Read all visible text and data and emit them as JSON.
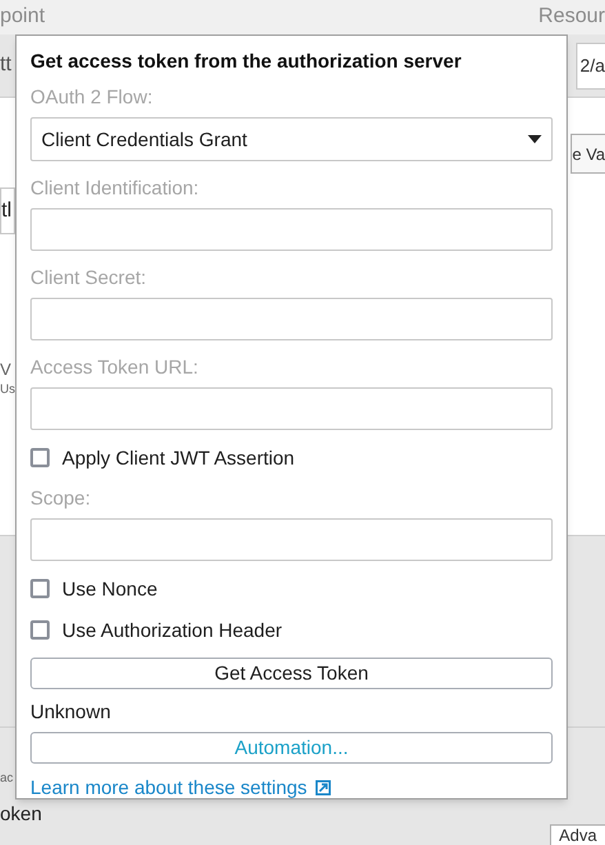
{
  "background": {
    "header_left": "point",
    "header_right": "Resour",
    "row_left": "tt",
    "row_right": "2/a",
    "button_right": "e Va",
    "field_left": "tl",
    "big_letter": "V",
    "caption_left": "Us",
    "label_left": "ac",
    "value_left": "oken",
    "advanced_button": "Adva"
  },
  "dialog": {
    "title": "Get access token from the authorization server",
    "items": [
      {
        "kind": "select",
        "label": "OAuth 2 Flow:",
        "value": "Client Credentials Grant"
      },
      {
        "kind": "input",
        "label": "Client Identification:"
      },
      {
        "kind": "input",
        "label": "Client Secret:"
      },
      {
        "kind": "input",
        "label": "Access Token URL:"
      },
      {
        "kind": "checkbox",
        "label": "Apply Client JWT Assertion",
        "checked": false
      },
      {
        "kind": "input",
        "label": "Scope:"
      },
      {
        "kind": "checkbox",
        "label": "Use Nonce",
        "checked": false
      },
      {
        "kind": "checkbox",
        "label": "Use Authorization Header",
        "checked": false
      }
    ],
    "get_token_button": "Get Access Token",
    "status": "Unknown",
    "automation_button": "Automation...",
    "learn_more_link": "Learn more about these settings"
  }
}
